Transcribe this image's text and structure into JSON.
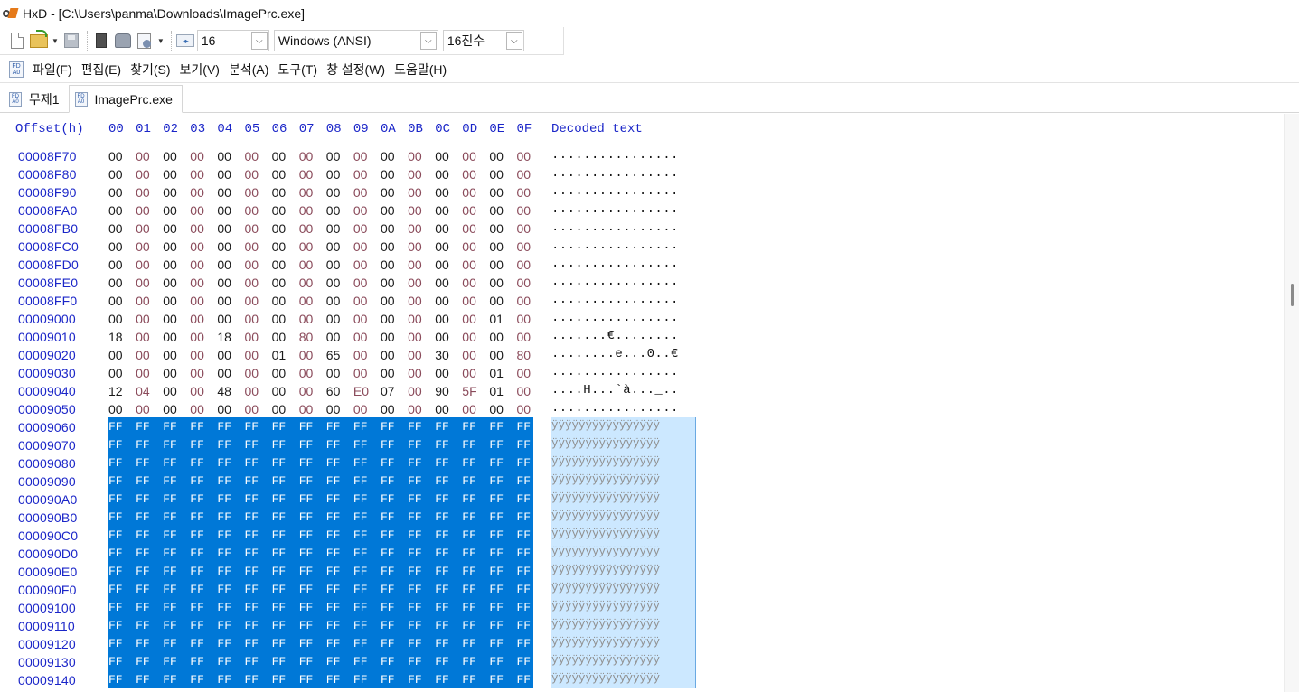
{
  "window": {
    "title": "HxD - [C:\\Users\\panma\\Downloads\\ImagePrc.exe]"
  },
  "toolbar": {
    "bytes_per_row": "16",
    "charset": "Windows (ANSI)",
    "offset_base": "16진수",
    "icons": [
      "new-file-icon",
      "open-file-icon",
      "save-icon",
      "disk-icon",
      "ram-icon",
      "document-icon",
      "bytes-per-row-icon"
    ]
  },
  "menu": [
    "파일(F)",
    "편집(E)",
    "찾기(S)",
    "보기(V)",
    "분석(A)",
    "도구(T)",
    "창 설정(W)",
    "도움말(H)"
  ],
  "tabs": [
    {
      "label": "무제1",
      "active": false
    },
    {
      "label": "ImagePrc.exe",
      "active": true
    }
  ],
  "hex": {
    "offset_header": "Offset(h)",
    "columns": [
      "00",
      "01",
      "02",
      "03",
      "04",
      "05",
      "06",
      "07",
      "08",
      "09",
      "0A",
      "0B",
      "0C",
      "0D",
      "0E",
      "0F"
    ],
    "decoded_header": "Decoded text",
    "rows": [
      {
        "offset": "00008F70",
        "bytes": [
          "00",
          "00",
          "00",
          "00",
          "00",
          "00",
          "00",
          "00",
          "00",
          "00",
          "00",
          "00",
          "00",
          "00",
          "00",
          "00"
        ],
        "text": "................",
        "selected": false
      },
      {
        "offset": "00008F80",
        "bytes": [
          "00",
          "00",
          "00",
          "00",
          "00",
          "00",
          "00",
          "00",
          "00",
          "00",
          "00",
          "00",
          "00",
          "00",
          "00",
          "00"
        ],
        "text": "................",
        "selected": false
      },
      {
        "offset": "00008F90",
        "bytes": [
          "00",
          "00",
          "00",
          "00",
          "00",
          "00",
          "00",
          "00",
          "00",
          "00",
          "00",
          "00",
          "00",
          "00",
          "00",
          "00"
        ],
        "text": "................",
        "selected": false
      },
      {
        "offset": "00008FA0",
        "bytes": [
          "00",
          "00",
          "00",
          "00",
          "00",
          "00",
          "00",
          "00",
          "00",
          "00",
          "00",
          "00",
          "00",
          "00",
          "00",
          "00"
        ],
        "text": "................",
        "selected": false
      },
      {
        "offset": "00008FB0",
        "bytes": [
          "00",
          "00",
          "00",
          "00",
          "00",
          "00",
          "00",
          "00",
          "00",
          "00",
          "00",
          "00",
          "00",
          "00",
          "00",
          "00"
        ],
        "text": "................",
        "selected": false
      },
      {
        "offset": "00008FC0",
        "bytes": [
          "00",
          "00",
          "00",
          "00",
          "00",
          "00",
          "00",
          "00",
          "00",
          "00",
          "00",
          "00",
          "00",
          "00",
          "00",
          "00"
        ],
        "text": "................",
        "selected": false
      },
      {
        "offset": "00008FD0",
        "bytes": [
          "00",
          "00",
          "00",
          "00",
          "00",
          "00",
          "00",
          "00",
          "00",
          "00",
          "00",
          "00",
          "00",
          "00",
          "00",
          "00"
        ],
        "text": "................",
        "selected": false
      },
      {
        "offset": "00008FE0",
        "bytes": [
          "00",
          "00",
          "00",
          "00",
          "00",
          "00",
          "00",
          "00",
          "00",
          "00",
          "00",
          "00",
          "00",
          "00",
          "00",
          "00"
        ],
        "text": "................",
        "selected": false
      },
      {
        "offset": "00008FF0",
        "bytes": [
          "00",
          "00",
          "00",
          "00",
          "00",
          "00",
          "00",
          "00",
          "00",
          "00",
          "00",
          "00",
          "00",
          "00",
          "00",
          "00"
        ],
        "text": "................",
        "selected": false
      },
      {
        "offset": "00009000",
        "bytes": [
          "00",
          "00",
          "00",
          "00",
          "00",
          "00",
          "00",
          "00",
          "00",
          "00",
          "00",
          "00",
          "00",
          "00",
          "01",
          "00"
        ],
        "text": "................",
        "selected": false
      },
      {
        "offset": "00009010",
        "bytes": [
          "18",
          "00",
          "00",
          "00",
          "18",
          "00",
          "00",
          "80",
          "00",
          "00",
          "00",
          "00",
          "00",
          "00",
          "00",
          "00"
        ],
        "text": ".......€........",
        "selected": false
      },
      {
        "offset": "00009020",
        "bytes": [
          "00",
          "00",
          "00",
          "00",
          "00",
          "00",
          "01",
          "00",
          "65",
          "00",
          "00",
          "00",
          "30",
          "00",
          "00",
          "80"
        ],
        "text": "........e...0..€",
        "selected": false
      },
      {
        "offset": "00009030",
        "bytes": [
          "00",
          "00",
          "00",
          "00",
          "00",
          "00",
          "00",
          "00",
          "00",
          "00",
          "00",
          "00",
          "00",
          "00",
          "01",
          "00"
        ],
        "text": "................",
        "selected": false
      },
      {
        "offset": "00009040",
        "bytes": [
          "12",
          "04",
          "00",
          "00",
          "48",
          "00",
          "00",
          "00",
          "60",
          "E0",
          "07",
          "00",
          "90",
          "5F",
          "01",
          "00"
        ],
        "text": "....H...`à..._..",
        "selected": false
      },
      {
        "offset": "00009050",
        "bytes": [
          "00",
          "00",
          "00",
          "00",
          "00",
          "00",
          "00",
          "00",
          "00",
          "00",
          "00",
          "00",
          "00",
          "00",
          "00",
          "00"
        ],
        "text": "................",
        "selected": false
      },
      {
        "offset": "00009060",
        "bytes": [
          "FF",
          "FF",
          "FF",
          "FF",
          "FF",
          "FF",
          "FF",
          "FF",
          "FF",
          "FF",
          "FF",
          "FF",
          "FF",
          "FF",
          "FF",
          "FF"
        ],
        "text": "ÿÿÿÿÿÿÿÿÿÿÿÿÿÿÿÿ",
        "selected": true
      },
      {
        "offset": "00009070",
        "bytes": [
          "FF",
          "FF",
          "FF",
          "FF",
          "FF",
          "FF",
          "FF",
          "FF",
          "FF",
          "FF",
          "FF",
          "FF",
          "FF",
          "FF",
          "FF",
          "FF"
        ],
        "text": "ÿÿÿÿÿÿÿÿÿÿÿÿÿÿÿÿ",
        "selected": true
      },
      {
        "offset": "00009080",
        "bytes": [
          "FF",
          "FF",
          "FF",
          "FF",
          "FF",
          "FF",
          "FF",
          "FF",
          "FF",
          "FF",
          "FF",
          "FF",
          "FF",
          "FF",
          "FF",
          "FF"
        ],
        "text": "ÿÿÿÿÿÿÿÿÿÿÿÿÿÿÿÿ",
        "selected": true
      },
      {
        "offset": "00009090",
        "bytes": [
          "FF",
          "FF",
          "FF",
          "FF",
          "FF",
          "FF",
          "FF",
          "FF",
          "FF",
          "FF",
          "FF",
          "FF",
          "FF",
          "FF",
          "FF",
          "FF"
        ],
        "text": "ÿÿÿÿÿÿÿÿÿÿÿÿÿÿÿÿ",
        "selected": true
      },
      {
        "offset": "000090A0",
        "bytes": [
          "FF",
          "FF",
          "FF",
          "FF",
          "FF",
          "FF",
          "FF",
          "FF",
          "FF",
          "FF",
          "FF",
          "FF",
          "FF",
          "FF",
          "FF",
          "FF"
        ],
        "text": "ÿÿÿÿÿÿÿÿÿÿÿÿÿÿÿÿ",
        "selected": true
      },
      {
        "offset": "000090B0",
        "bytes": [
          "FF",
          "FF",
          "FF",
          "FF",
          "FF",
          "FF",
          "FF",
          "FF",
          "FF",
          "FF",
          "FF",
          "FF",
          "FF",
          "FF",
          "FF",
          "FF"
        ],
        "text": "ÿÿÿÿÿÿÿÿÿÿÿÿÿÿÿÿ",
        "selected": true
      },
      {
        "offset": "000090C0",
        "bytes": [
          "FF",
          "FF",
          "FF",
          "FF",
          "FF",
          "FF",
          "FF",
          "FF",
          "FF",
          "FF",
          "FF",
          "FF",
          "FF",
          "FF",
          "FF",
          "FF"
        ],
        "text": "ÿÿÿÿÿÿÿÿÿÿÿÿÿÿÿÿ",
        "selected": true
      },
      {
        "offset": "000090D0",
        "bytes": [
          "FF",
          "FF",
          "FF",
          "FF",
          "FF",
          "FF",
          "FF",
          "FF",
          "FF",
          "FF",
          "FF",
          "FF",
          "FF",
          "FF",
          "FF",
          "FF"
        ],
        "text": "ÿÿÿÿÿÿÿÿÿÿÿÿÿÿÿÿ",
        "selected": true
      },
      {
        "offset": "000090E0",
        "bytes": [
          "FF",
          "FF",
          "FF",
          "FF",
          "FF",
          "FF",
          "FF",
          "FF",
          "FF",
          "FF",
          "FF",
          "FF",
          "FF",
          "FF",
          "FF",
          "FF"
        ],
        "text": "ÿÿÿÿÿÿÿÿÿÿÿÿÿÿÿÿ",
        "selected": true
      },
      {
        "offset": "000090F0",
        "bytes": [
          "FF",
          "FF",
          "FF",
          "FF",
          "FF",
          "FF",
          "FF",
          "FF",
          "FF",
          "FF",
          "FF",
          "FF",
          "FF",
          "FF",
          "FF",
          "FF"
        ],
        "text": "ÿÿÿÿÿÿÿÿÿÿÿÿÿÿÿÿ",
        "selected": true
      },
      {
        "offset": "00009100",
        "bytes": [
          "FF",
          "FF",
          "FF",
          "FF",
          "FF",
          "FF",
          "FF",
          "FF",
          "FF",
          "FF",
          "FF",
          "FF",
          "FF",
          "FF",
          "FF",
          "FF"
        ],
        "text": "ÿÿÿÿÿÿÿÿÿÿÿÿÿÿÿÿ",
        "selected": true
      },
      {
        "offset": "00009110",
        "bytes": [
          "FF",
          "FF",
          "FF",
          "FF",
          "FF",
          "FF",
          "FF",
          "FF",
          "FF",
          "FF",
          "FF",
          "FF",
          "FF",
          "FF",
          "FF",
          "FF"
        ],
        "text": "ÿÿÿÿÿÿÿÿÿÿÿÿÿÿÿÿ",
        "selected": true
      },
      {
        "offset": "00009120",
        "bytes": [
          "FF",
          "FF",
          "FF",
          "FF",
          "FF",
          "FF",
          "FF",
          "FF",
          "FF",
          "FF",
          "FF",
          "FF",
          "FF",
          "FF",
          "FF",
          "FF"
        ],
        "text": "ÿÿÿÿÿÿÿÿÿÿÿÿÿÿÿÿ",
        "selected": true
      },
      {
        "offset": "00009130",
        "bytes": [
          "FF",
          "FF",
          "FF",
          "FF",
          "FF",
          "FF",
          "FF",
          "FF",
          "FF",
          "FF",
          "FF",
          "FF",
          "FF",
          "FF",
          "FF",
          "FF"
        ],
        "text": "ÿÿÿÿÿÿÿÿÿÿÿÿÿÿÿÿ",
        "selected": true
      },
      {
        "offset": "00009140",
        "bytes": [
          "FF",
          "FF",
          "FF",
          "FF",
          "FF",
          "FF",
          "FF",
          "FF",
          "FF",
          "FF",
          "FF",
          "FF",
          "FF",
          "FF",
          "FF",
          "FF"
        ],
        "text": "ÿÿÿÿÿÿÿÿÿÿÿÿÿÿÿÿ",
        "selected": true
      }
    ]
  },
  "colors": {
    "offset_text": "#1a25c8",
    "even_byte": "#1a1a1a",
    "odd_byte": "#8a4a5a",
    "selection_hex": "#0078d7",
    "selection_text": "#cce8ff"
  }
}
